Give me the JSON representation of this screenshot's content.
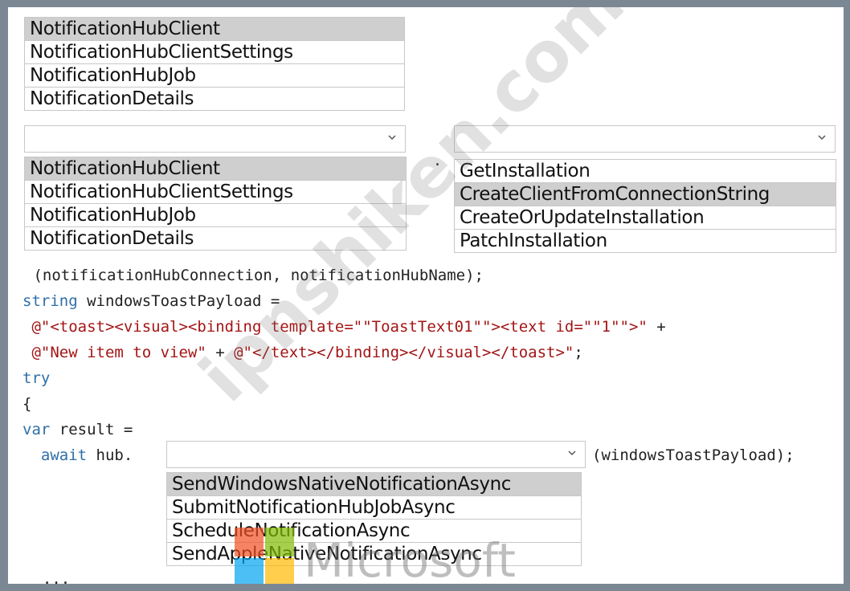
{
  "dropdown_1": {
    "options": [
      "NotificationHubClient",
      "NotificationHubClientSettings",
      "NotificationHubJob",
      "NotificationDetails"
    ],
    "selected_index": 0
  },
  "dropdown_2": {
    "options": [
      "NotificationHubClient",
      "NotificationHubClientSettings",
      "NotificationHubJob",
      "NotificationDetails"
    ],
    "selected_index": 0
  },
  "separator_dot": ".",
  "dropdown_3": {
    "options": [
      "GetInstallation",
      "CreateClientFromConnectionString",
      "CreateOrUpdateInstallation",
      "PatchInstallation"
    ],
    "selected_index": 1
  },
  "code": {
    "line1": " (notificationHubConnection, notificationHubName);",
    "line2_kw": "string",
    "line2_rest": " windowsToastPayload =",
    "line3_str": " @\"<toast><visual><binding template=\"\"ToastText01\"\"><text id=\"\"1\"\">\"",
    "line3_rest": " +",
    "line4_str1": " @\"New item to view\"",
    "line4_mid": " + ",
    "line4_str2": "@\"</text></binding></visual></toast>\"",
    "line4_end": ";",
    "line5_kw": "try",
    "line6": "{",
    "line7_kw": "var",
    "line7_rest": " result =",
    "line8_kw": "  await",
    "line8_rest": " hub.",
    "line8_after": "(windowsToastPayload);",
    "line9": "  ..."
  },
  "dropdown_4": {
    "options": [
      "SendWindowsNativeNotificationAsync",
      "SubmitNotificationHubJobAsync",
      "ScheduleNotificationAsync",
      "SendAppleNativeNotificationAsync"
    ],
    "selected_index": 0
  },
  "watermark": "ipnshiken.com",
  "logo": {
    "text": "Microsoft",
    "colors": [
      "#f25022",
      "#7fba00",
      "#00a4ef",
      "#ffb900"
    ]
  }
}
